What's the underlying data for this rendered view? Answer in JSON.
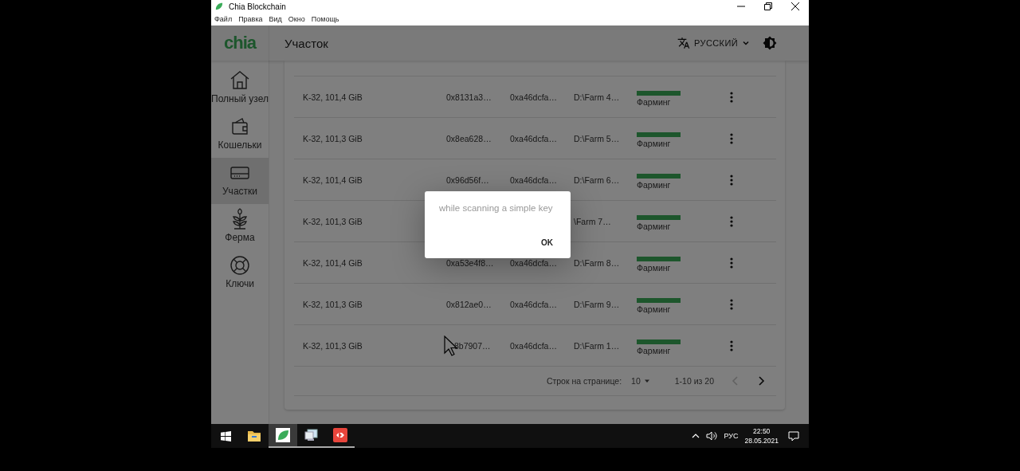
{
  "window": {
    "title": "Chia Blockchain"
  },
  "menu": [
    "Файл",
    "Правка",
    "Вид",
    "Окно",
    "Помощь"
  ],
  "header": {
    "logo": "chia",
    "title": "Участок",
    "language": "РУССКИЙ"
  },
  "sidebar": {
    "items": [
      {
        "label": "Полный узел",
        "kind": "home",
        "selected": false
      },
      {
        "label": "Кошельки",
        "kind": "wallet",
        "selected": false
      },
      {
        "label": "Участки",
        "kind": "drive",
        "selected": true
      },
      {
        "label": "Ферма",
        "kind": "plant",
        "selected": false
      },
      {
        "label": "Ключи",
        "kind": "lifebuoy",
        "selected": false
      }
    ]
  },
  "table": {
    "rows": [
      {
        "size": "K-32, 101,4 GiB",
        "plot_key": "0x8131a3…",
        "pool_key": "0xa46dcfa…",
        "filename": "D:\\Farm 4…",
        "status": "Фарминг"
      },
      {
        "size": "K-32, 101,3 GiB",
        "plot_key": "0x8ea628…",
        "pool_key": "0xa46dcfa…",
        "filename": "D:\\Farm 5…",
        "status": "Фарминг"
      },
      {
        "size": "K-32, 101,4 GiB",
        "plot_key": "0x96d56f…",
        "pool_key": "0xa46dcfa…",
        "filename": "D:\\Farm 6…",
        "status": "Фарминг"
      },
      {
        "size": "K-32, 101,3 GiB",
        "filename": "\\Farm 7…",
        "status": "Фарминг"
      },
      {
        "size": "K-32, 101,4 GiB",
        "plot_key": "0xa53e4f8…",
        "pool_key": "0xa46dcfa…",
        "filename": "D:\\Farm 8…",
        "status": "Фарминг"
      },
      {
        "size": "K-32, 101,3 GiB",
        "plot_key": "0x812ae0…",
        "pool_key": "0xa46dcfa…",
        "filename": "D:\\Farm 9…",
        "status": "Фарминг"
      },
      {
        "size": "K-32, 101,3 GiB",
        "plot_key": "8b7907…",
        "pool_key": "0xa46dcfa…",
        "filename": "D:\\Farm 1…",
        "status": "Фарминг",
        "under_cursor": true
      }
    ]
  },
  "pagination": {
    "rows_per_page_label": "Строк на странице:",
    "rows_per_page": "10",
    "range": "1-10 из 20",
    "prev_disabled": true,
    "next_disabled": false
  },
  "dialog": {
    "message": "while scanning a simple key",
    "button": "OK"
  },
  "taskbar": {
    "apps": [
      {
        "kind": "folder",
        "running": false,
        "selected": false
      },
      {
        "kind": "leaf",
        "running": true,
        "selected": true
      },
      {
        "kind": "computer",
        "running": true,
        "selected": false
      },
      {
        "kind": "remote",
        "running": true,
        "selected": false
      }
    ],
    "language": "РУС",
    "time": "22:50",
    "date": "28.05.2021"
  }
}
